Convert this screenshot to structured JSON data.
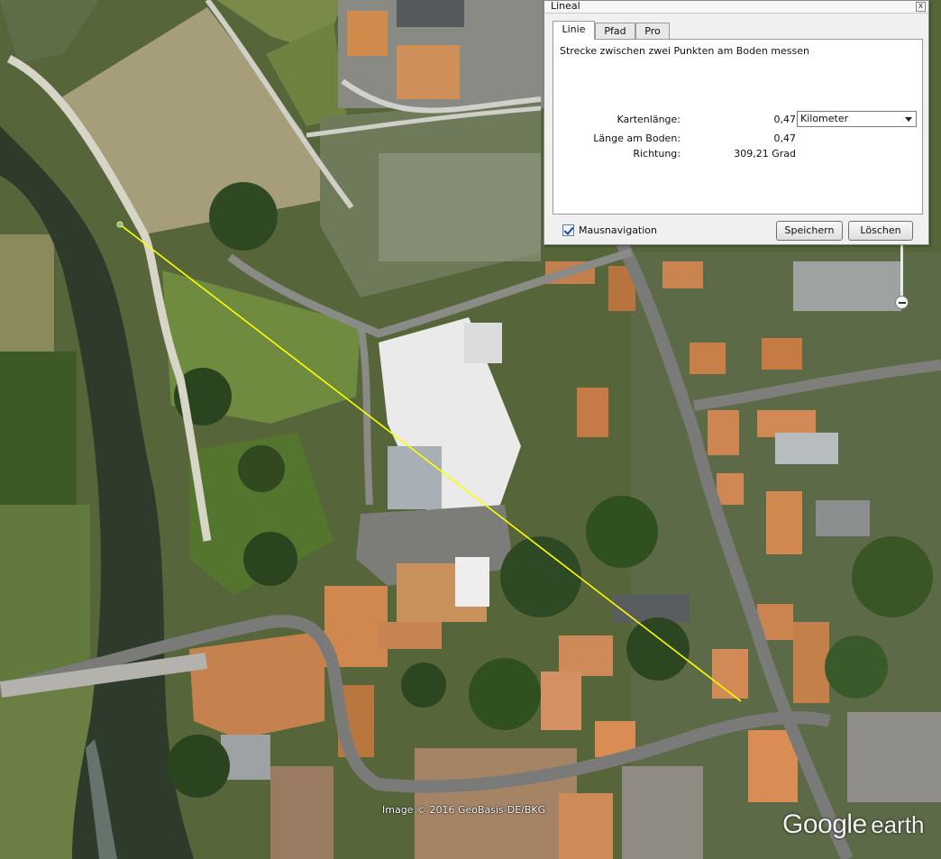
{
  "map": {
    "attribution": "Image © 2016 GeoBasis-DE/BKG",
    "brand_google": "Google",
    "brand_earth": "earth",
    "measure_line_color": "#ffff00"
  },
  "dialog": {
    "title": "Lineal",
    "close_glyph": "x",
    "tabs": [
      {
        "label": "Linie",
        "active": true
      },
      {
        "label": "Pfad",
        "active": false
      },
      {
        "label": "Pro",
        "active": false
      }
    ],
    "description": "Strecke zwischen zwei Punkten am Boden messen",
    "map_length": {
      "label": "Kartenlänge:",
      "value": "0,47"
    },
    "unit_select": {
      "selected": "Kilometer"
    },
    "ground_length": {
      "label": "Länge am Boden:",
      "value": "0,47"
    },
    "heading": {
      "label": "Richtung:",
      "value": "309,21 Grad"
    },
    "mouse_navigation": {
      "label": "Mausnavigation",
      "checked": true
    },
    "buttons": {
      "save": "Speichern",
      "clear": "Löschen"
    }
  }
}
